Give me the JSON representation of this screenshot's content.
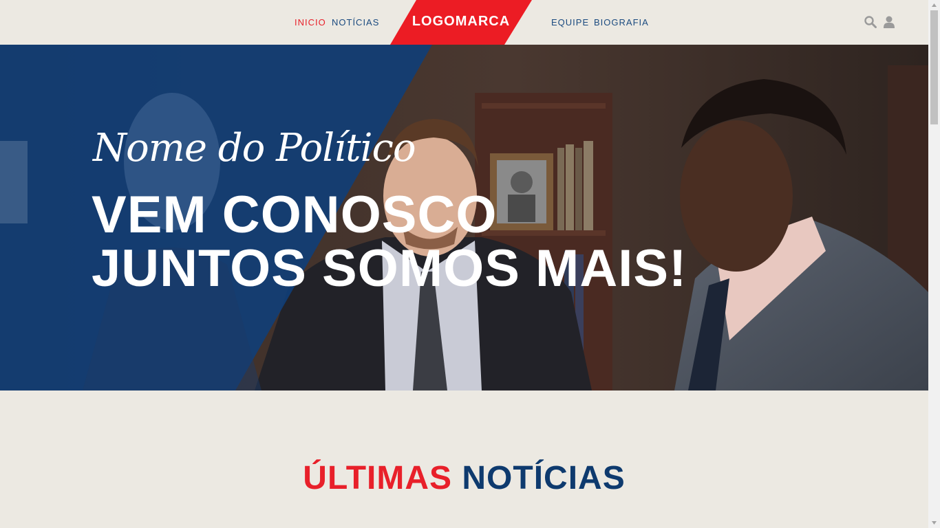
{
  "nav": {
    "left": [
      {
        "label": "INICIO",
        "active": true
      },
      {
        "label": "NOTÍCIAS",
        "active": false
      }
    ],
    "right": [
      {
        "label": "EQUIPE",
        "active": false
      },
      {
        "label": "BIOGRAFIA",
        "active": false
      }
    ],
    "logo": "LOGOMARCA",
    "icons": [
      "search-icon",
      "user-icon"
    ]
  },
  "hero": {
    "subtitle": "Nome do Político",
    "line1": "VEM CONOSCO",
    "line2": "JUNTOS SOMOS MAIS!"
  },
  "section": {
    "title_red": "ÚLTIMAS",
    "title_blue": "NOTÍCIAS"
  },
  "colors": {
    "accent_red": "#e8202a",
    "accent_blue": "#0e3a6e",
    "background": "#ece9e2"
  }
}
